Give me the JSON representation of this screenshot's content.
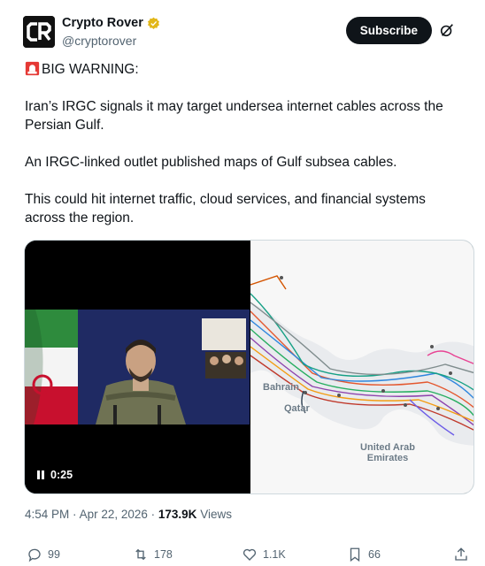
{
  "author": {
    "display_name": "Crypto Rover",
    "handle": "@cryptorover",
    "avatar_text": "CR",
    "verified_badge": "gold-verified-badge"
  },
  "header": {
    "subscribe_label": "Subscribe",
    "grok_icon": "grok-icon"
  },
  "tweet": {
    "warning_line": "BIG WARNING:",
    "warning_icon": "siren-emoji",
    "paragraph_1": "Iran’s IRGC signals it may target undersea internet cables across the Persian Gulf.",
    "paragraph_2": "An IRGC-linked outlet published maps of Gulf subsea cables.",
    "paragraph_3": "This could hit internet traffic, cloud services, and financial systems across the region."
  },
  "media": {
    "video_duration": "0:25",
    "map_labels": {
      "bahrain": "Bahrain",
      "qatar": "Qatar",
      "uae": "United Arab Emirates"
    }
  },
  "meta": {
    "time": "4:54 PM",
    "date": "Apr 22, 2026",
    "views_count": "173.9K",
    "views_label": "Views"
  },
  "actions": {
    "replies": "99",
    "reposts": "178",
    "likes": "1.1K",
    "bookmarks": "66"
  },
  "colors": {
    "text_primary": "#0f1419",
    "text_secondary": "#536471",
    "badge_gold": "#e2b719",
    "subscribe_bg": "#0f1419"
  }
}
